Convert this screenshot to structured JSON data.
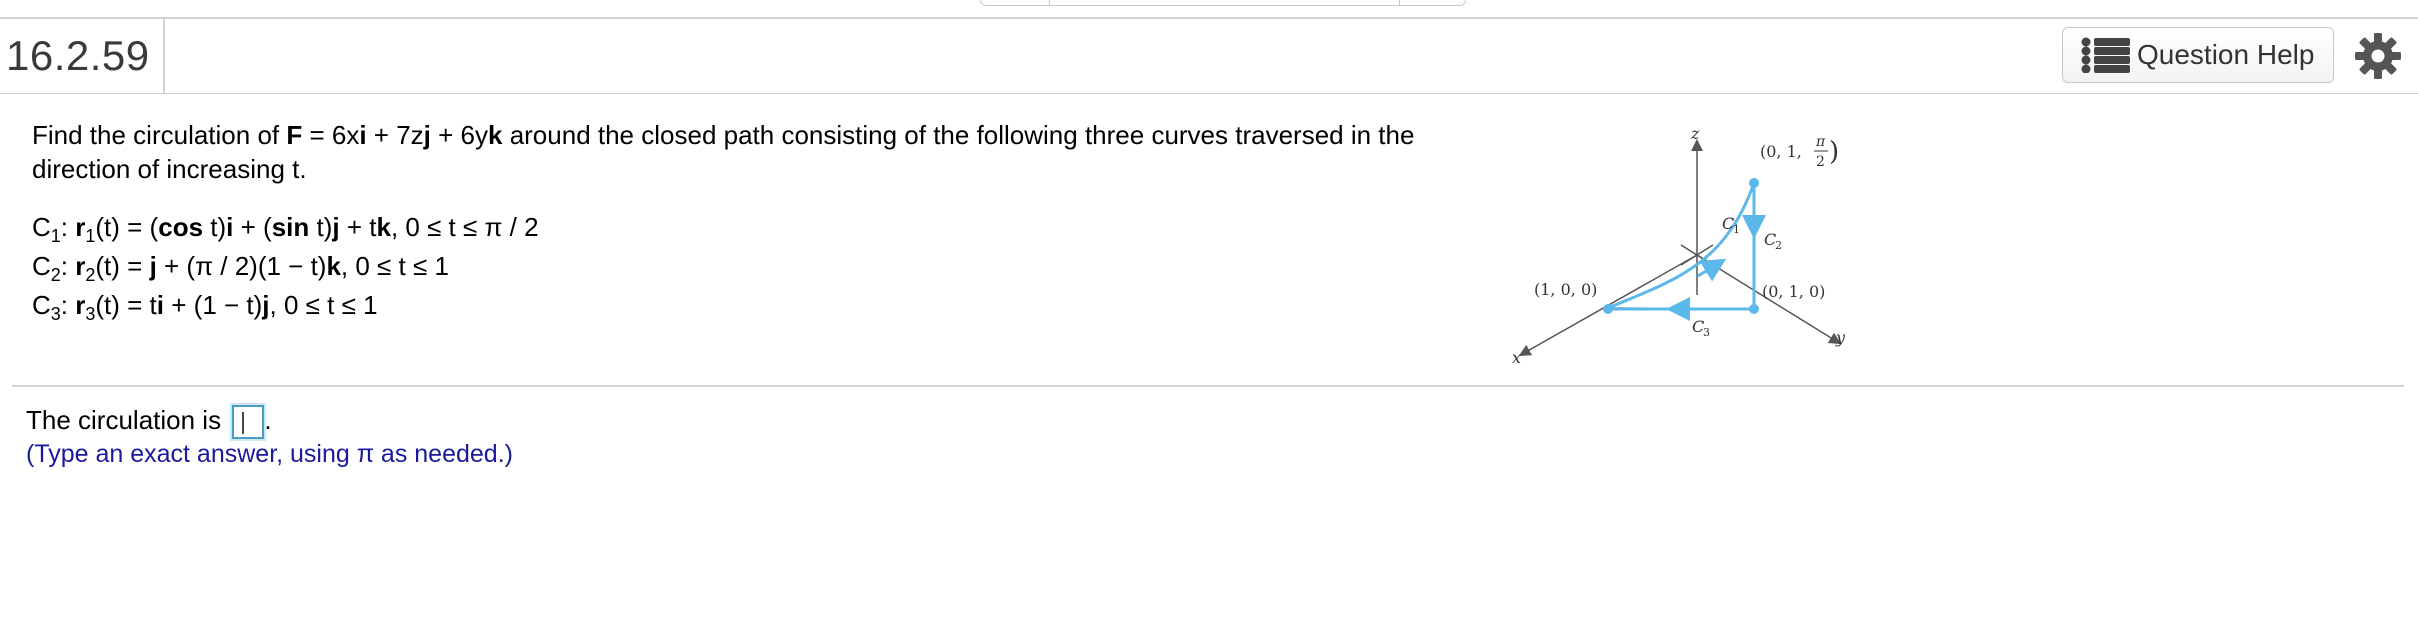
{
  "header": {
    "question_number": "16.2.59",
    "help_label": "Question Help"
  },
  "question": {
    "prompt_lead": "Find the circulation of ",
    "field_F": "F",
    "eq": " = 6x",
    "i": "i",
    "plus1": " + 7z",
    "j": "j",
    "plus2": " + 6y",
    "k": "k",
    "prompt_tail": " around the closed path consisting of the following three curves traversed in the direction of increasing t.",
    "curves": [
      {
        "name": "C",
        "sub": "1",
        "text": "r₁(t) = (cos t)i + (sin t)j + tk, 0 ≤ t ≤ π / 2"
      },
      {
        "name": "C",
        "sub": "2",
        "text": "r₂(t) = j + (π / 2)(1 − t)k, 0 ≤ t ≤ 1"
      },
      {
        "name": "C",
        "sub": "3",
        "text": "r₃(t) = ti + (1 − t)j, 0 ≤ t ≤ 1"
      }
    ]
  },
  "answer": {
    "lead": "The circulation is ",
    "trail": ".",
    "hint": "(Type an exact answer, using π as needed.)"
  },
  "figure": {
    "axis_z": "z",
    "axis_x": "x",
    "axis_y": "y",
    "pt_top": "(0, 1, π/2)",
    "pt_top_lead": "(0, 1,",
    "pi": "π",
    "two": "2",
    "pt_left": "(1, 0, 0)",
    "pt_right": "(0, 1, 0)",
    "c1": "C",
    "c1_sub": "1",
    "c2": "C",
    "c2_sub": "2",
    "c3": "C",
    "c3_sub": "3",
    "curve_color": "#5bb8ea"
  },
  "colors": {
    "hint": "#1a1a9a",
    "answer_box_border": "#4a9bc8"
  }
}
